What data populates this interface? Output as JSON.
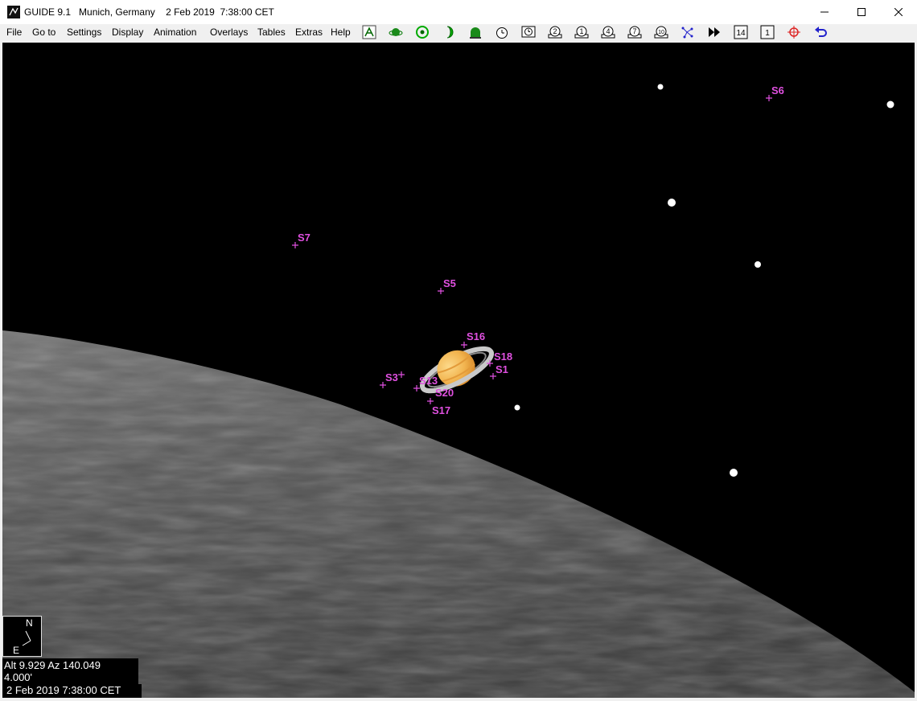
{
  "window": {
    "app": "GUIDE 9.1",
    "location": "Munich, Germany",
    "datetime": "2 Feb 2019  7:38:00 CET"
  },
  "menu": [
    "File",
    "Go to",
    "Settings",
    "Display",
    "Animation",
    "Overlays",
    "Tables",
    "Extras",
    "Help"
  ],
  "toolbar": [
    {
      "icon": "chart-icon"
    },
    {
      "icon": "planet-icon"
    },
    {
      "icon": "target-icon"
    },
    {
      "icon": "moon-phase-icon"
    },
    {
      "icon": "observatory-icon"
    },
    {
      "icon": "clock-icon"
    },
    {
      "icon": "screen-clock-icon"
    },
    {
      "icon": "zoom-2-icon"
    },
    {
      "icon": "zoom-1-icon"
    },
    {
      "icon": "zoom-4-icon"
    },
    {
      "icon": "zoom-7-icon"
    },
    {
      "icon": "zoom-10-icon"
    },
    {
      "icon": "constellation-icon"
    },
    {
      "icon": "fast-forward-icon"
    },
    {
      "icon": "level-14-icon",
      "label": "14"
    },
    {
      "icon": "level-1-icon",
      "label": "1"
    },
    {
      "icon": "crosshair-icon"
    },
    {
      "icon": "undo-icon"
    }
  ],
  "sky": {
    "horizon_color": "#555555",
    "label_color": "#e050e0",
    "moon_labels": [
      "S6",
      "S7",
      "S5",
      "S16",
      "S18",
      "S1",
      "S3",
      "S13",
      "S17",
      "S20"
    ],
    "planet_color": "#f2b550"
  },
  "compass": {
    "north": "N",
    "east": "E"
  },
  "status": {
    "altaz": "Alt 9.929  Az 140.049",
    "field": "4.000'",
    "date": "2 Feb 2019  7:38:00 CET"
  }
}
